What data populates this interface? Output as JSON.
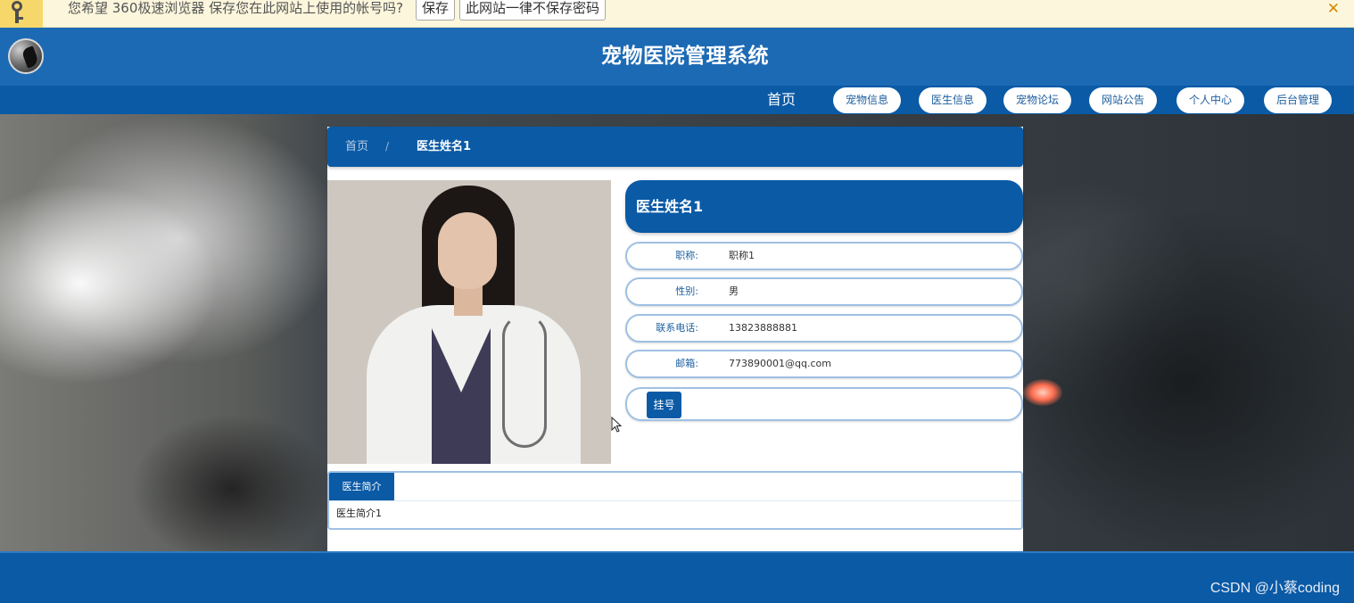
{
  "password_bar": {
    "message": "您希望 360极速浏览器 保存您在此网站上使用的帐号吗?",
    "save_label": "保存",
    "never_label": "此网站一律不保存密码",
    "close_glyph": "✕"
  },
  "header": {
    "title": "宠物医院管理系统"
  },
  "nav": {
    "home": "首页",
    "items": [
      {
        "label": "宠物信息"
      },
      {
        "label": "医生信息"
      },
      {
        "label": "宠物论坛"
      },
      {
        "label": "网站公告"
      },
      {
        "label": "个人中心"
      },
      {
        "label": "后台管理"
      }
    ]
  },
  "breadcrumb": {
    "home": "首页",
    "separator": "/",
    "current": "医生姓名1"
  },
  "doctor": {
    "name": "医生姓名1",
    "fields": [
      {
        "label": "职称:",
        "value": "职称1"
      },
      {
        "label": "性别:",
        "value": "男"
      },
      {
        "label": "联系电话:",
        "value": "13823888881"
      },
      {
        "label": "邮箱:",
        "value": "773890001@qq.com"
      }
    ],
    "register_label": "挂号",
    "intro_tab": "医生简介",
    "intro_text": "医生简介1"
  },
  "footer": {
    "watermark": "CSDN @小蔡coding"
  },
  "colors": {
    "primary": "#0a5aa6",
    "header": "#1d6ab4",
    "row_border": "#9fc0e4",
    "password_bar": "#fcf6dc"
  }
}
